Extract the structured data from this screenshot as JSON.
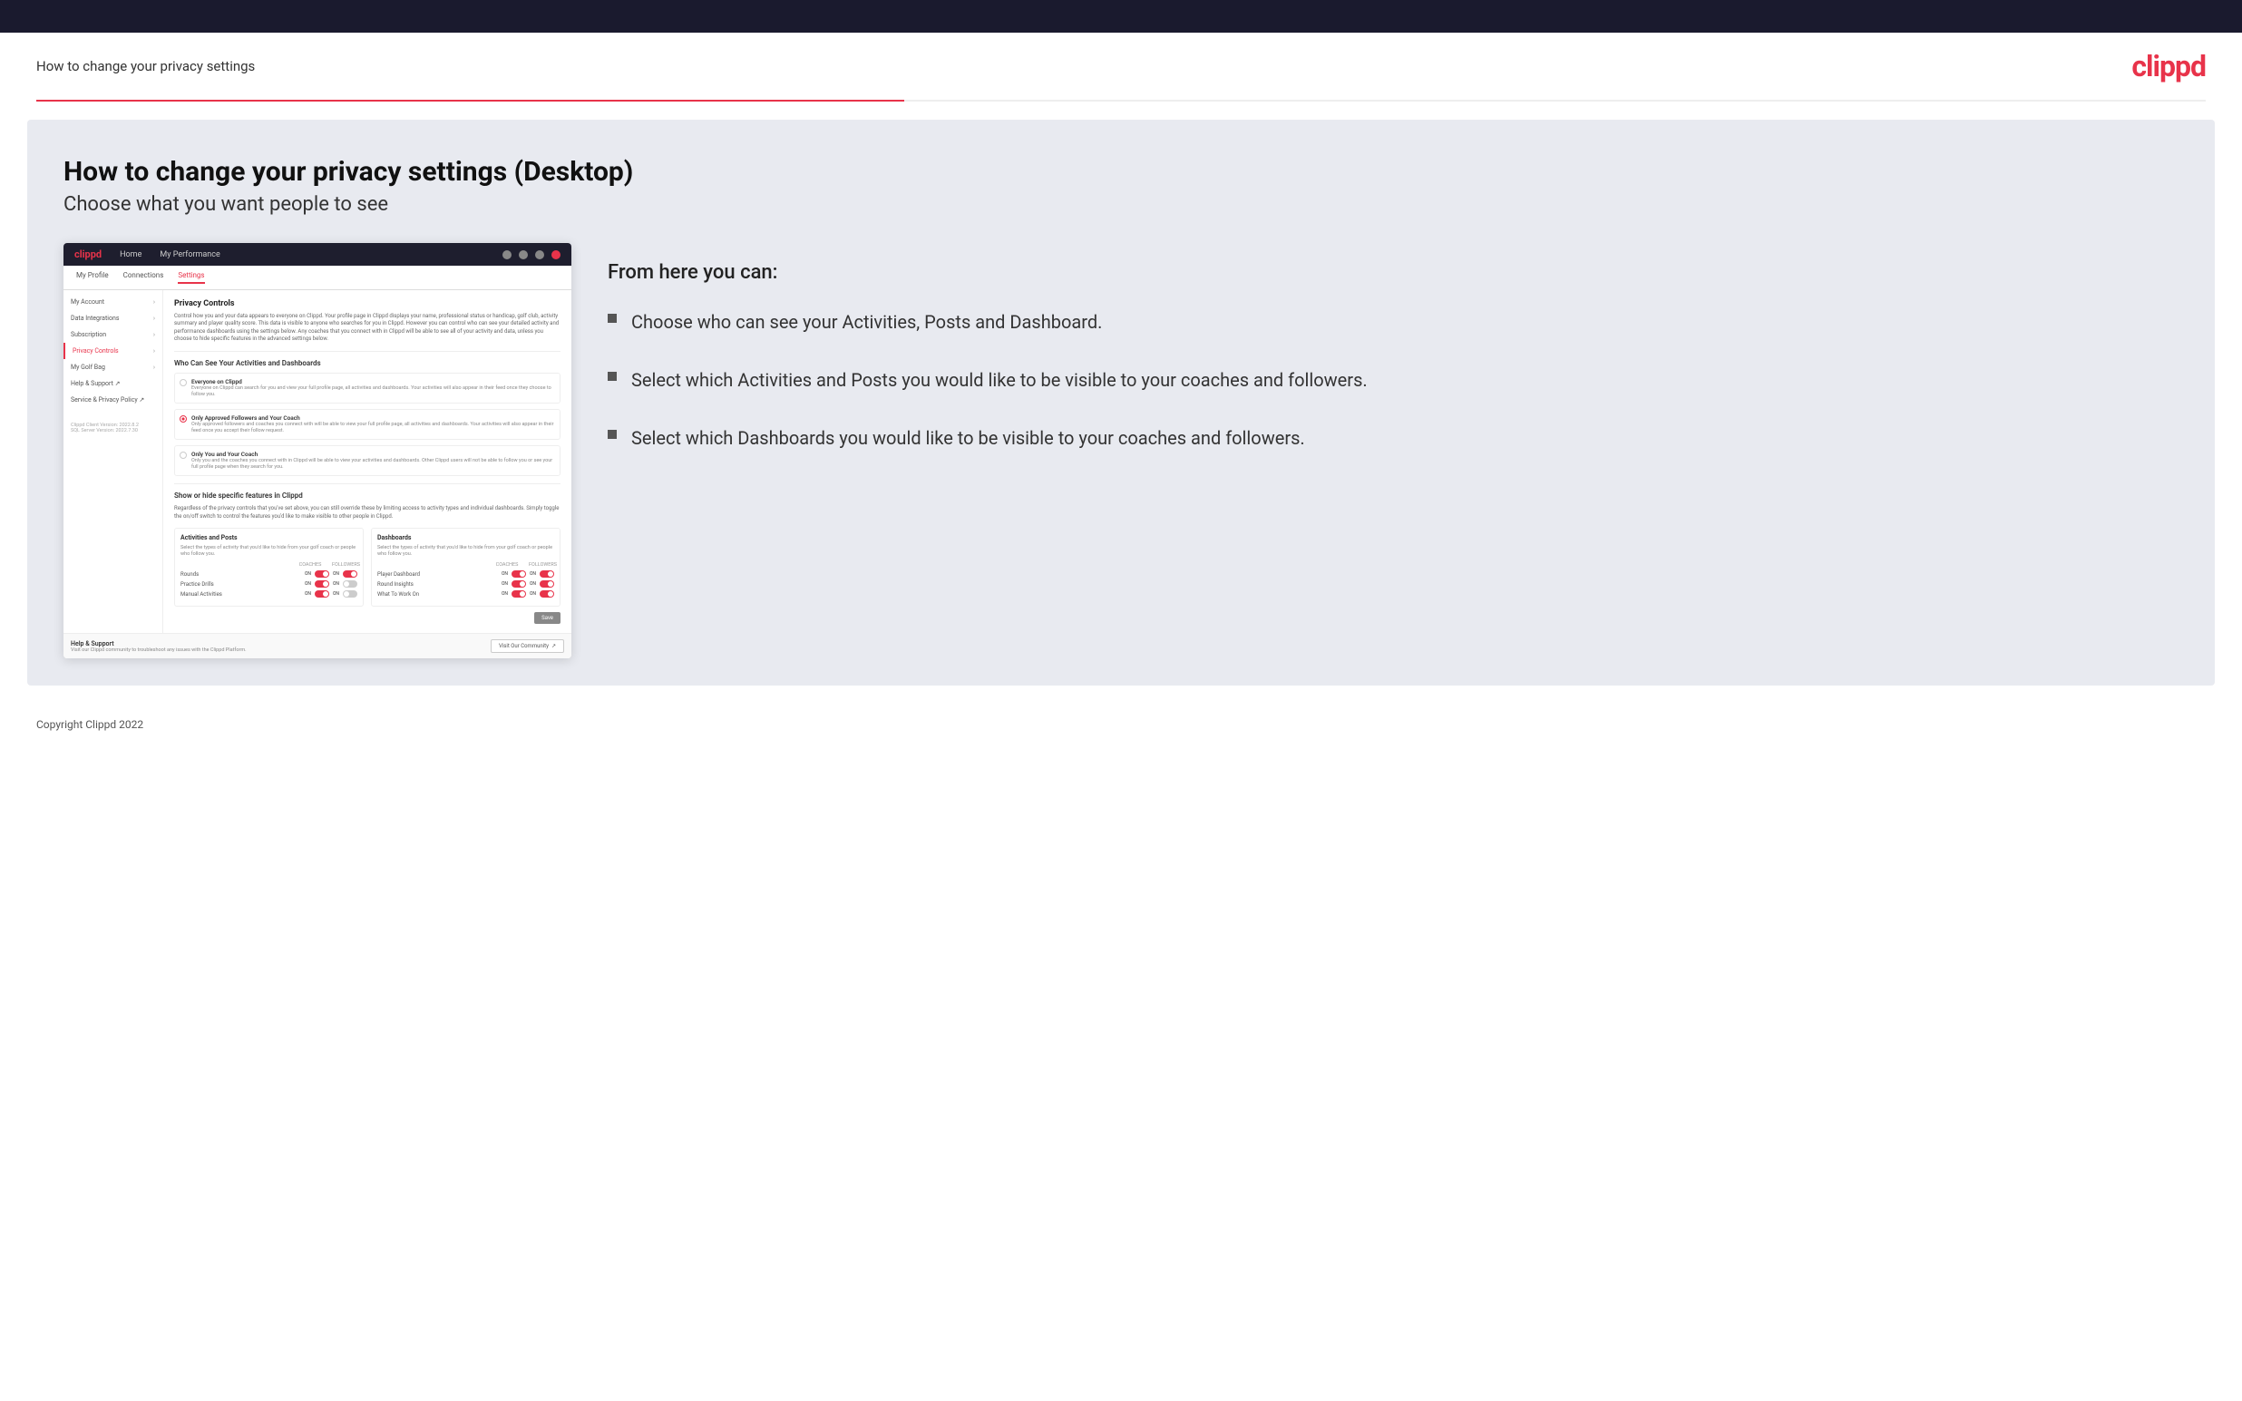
{
  "topBar": {},
  "header": {
    "title": "How to change your privacy settings",
    "logo": "clippd"
  },
  "page": {
    "heading": "How to change your privacy settings (Desktop)",
    "subheading": "Choose what you want people to see"
  },
  "mockup": {
    "nav": {
      "logo": "clippd",
      "items": [
        "Home",
        "My Performance"
      ]
    },
    "subnav": {
      "items": [
        "My Profile",
        "Connections",
        "Settings"
      ]
    },
    "sidebar": {
      "items": [
        {
          "label": "My Account",
          "active": false
        },
        {
          "label": "Data Integrations",
          "active": false
        },
        {
          "label": "Subscription",
          "active": false
        },
        {
          "label": "Privacy Controls",
          "active": true
        },
        {
          "label": "My Golf Bag",
          "active": false
        },
        {
          "label": "Help & Support",
          "active": false
        },
        {
          "label": "Service & Privacy Policy",
          "active": false
        }
      ],
      "version": "Clippd Client Version: 2022.8.2\nSQL Server Version: 2022.7.30"
    },
    "privacyControls": {
      "sectionTitle": "Privacy Controls",
      "sectionDesc": "Control how you and your data appears to everyone on Clippd. Your profile page in Clippd displays your name, professional status or handicap, golf club, activity summary and player quality score. This data is visible to anyone who searches for you in Clippd. However you can control who can see your detailed activity and performance dashboards using the settings below. Any coaches that you connect with in Clippd will be able to see all of your activity and data, unless you choose to hide specific features in the advanced settings below.",
      "whoCanSee": "Who Can See Your Activities and Dashboards",
      "radioOptions": [
        {
          "label": "Everyone on Clippd",
          "desc": "Everyone on Clippd can search for you and view your full profile page, all activities and dashboards. Your activities will also appear in their feed once they choose to follow you.",
          "selected": false
        },
        {
          "label": "Only Approved Followers and Your Coach",
          "desc": "Only approved followers and coaches you connect with will be able to view your full profile page, all activities and dashboards. Your activities will also appear in their feed once you accept their follow request.",
          "selected": true
        },
        {
          "label": "Only You and Your Coach",
          "desc": "Only you and the coaches you connect with in Clippd will be able to view your activities and dashboards. Other Clippd users will not be able to follow you or see your full profile page when they search for you.",
          "selected": false
        }
      ],
      "showHide": {
        "title": "Show or hide specific features in Clippd",
        "desc": "Regardless of the privacy controls that you've set above, you can still override these by limiting access to activity types and individual dashboards. Simply toggle the on/off switch to control the features you'd like to make visible to other people in Clippd."
      },
      "activitiesPosts": {
        "title": "Activities and Posts",
        "desc": "Select the types of activity that you'd like to hide from your golf coach or people who follow you.",
        "headers": [
          "COACHES",
          "FOLLOWERS"
        ],
        "rows": [
          {
            "label": "Rounds",
            "coachOn": true,
            "followersOn": true
          },
          {
            "label": "Practice Drills",
            "coachOn": true,
            "followersOn": false
          },
          {
            "label": "Manual Activities",
            "coachOn": true,
            "followersOn": false
          }
        ]
      },
      "dashboards": {
        "title": "Dashboards",
        "desc": "Select the types of activity that you'd like to hide from your golf coach or people who follow you.",
        "headers": [
          "COACHES",
          "FOLLOWERS"
        ],
        "rows": [
          {
            "label": "Player Dashboard",
            "coachOn": true,
            "followersOn": true
          },
          {
            "label": "Round Insights",
            "coachOn": true,
            "followersOn": true
          },
          {
            "label": "What To Work On",
            "coachOn": true,
            "followersOn": true
          }
        ]
      },
      "saveLabel": "Save"
    },
    "helpSection": {
      "title": "Help & Support",
      "desc": "Visit our Clippd community to troubleshoot any issues with the Clippd Platform.",
      "btnLabel": "Visit Our Community"
    }
  },
  "rightColumn": {
    "fromHereTitle": "From here you can:",
    "bullets": [
      "Choose who can see your Activities, Posts and Dashboard.",
      "Select which Activities and Posts you would like to be visible to your coaches and followers.",
      "Select which Dashboards you would like to be visible to your coaches and followers."
    ]
  },
  "footer": {
    "copyright": "Copyright Clippd 2022"
  }
}
